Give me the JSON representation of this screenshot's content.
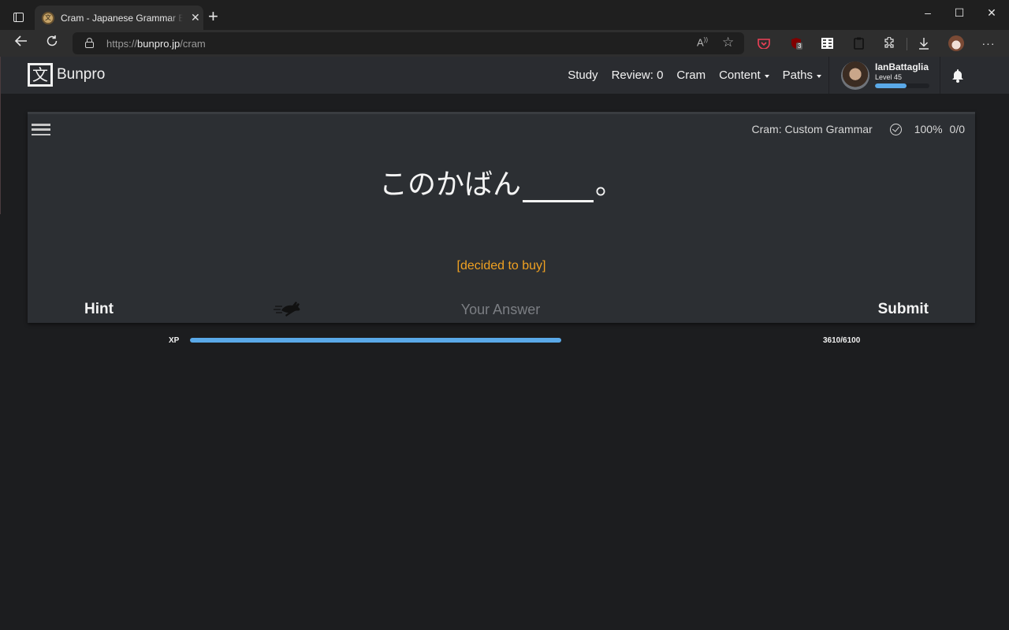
{
  "browser": {
    "tab": {
      "title": "Cram - Japanese Grammar Explanations",
      "favicon": "bunpro-favicon"
    },
    "new_tab_label": "+",
    "window_controls": {
      "minimize": "–",
      "maximize": "☐",
      "close": "✕"
    },
    "address": {
      "scheme": "https://",
      "domain": "bunpro.jp",
      "path": "/cram"
    },
    "extensions": [
      {
        "name": "read-aloud-icon",
        "glyph": "A))"
      },
      {
        "name": "add-favorite-icon",
        "glyph": "☆"
      },
      {
        "name": "pocket-icon",
        "glyph": "◡"
      },
      {
        "name": "ublock-icon",
        "glyph": "uD",
        "badge": "3"
      },
      {
        "name": "reader-icon",
        "glyph": "☰"
      },
      {
        "name": "clipboard-icon",
        "glyph": "📋"
      },
      {
        "name": "extensions-icon",
        "glyph": "✿"
      },
      {
        "name": "downloads-icon",
        "glyph": "⤓"
      },
      {
        "name": "profile-avatar",
        "glyph": ""
      },
      {
        "name": "more-icon",
        "glyph": "···"
      }
    ]
  },
  "site": {
    "brand": "Bunpro",
    "logo_glyph": "文",
    "nav": [
      {
        "label": "Study",
        "dropdown": false
      },
      {
        "label": "Review: 0",
        "dropdown": false
      },
      {
        "label": "Cram",
        "dropdown": false
      },
      {
        "label": "Content",
        "dropdown": true
      },
      {
        "label": "Paths",
        "dropdown": true
      }
    ],
    "user": {
      "name": "IanBattaglia",
      "level_label": "Level 45",
      "level_progress": 0.58
    }
  },
  "quiz": {
    "mode_label": "Cram: Custom Grammar",
    "accuracy": "100%",
    "count": "0/0",
    "sentence_before": "このかばん",
    "sentence_after": "。",
    "hint": "[decided to buy]",
    "hint_button": "Hint",
    "answer_placeholder": "Your Answer",
    "answer_value": "",
    "submit_button": "Submit"
  },
  "xp": {
    "label": "XP",
    "current": 3610,
    "total": 6100,
    "value_text": "3610/6100"
  },
  "colors": {
    "accent_blue": "#5aa9e8",
    "hint_orange": "#f0a121",
    "card_bg": "#2c2f33",
    "page_bg": "#1c1d1f"
  }
}
